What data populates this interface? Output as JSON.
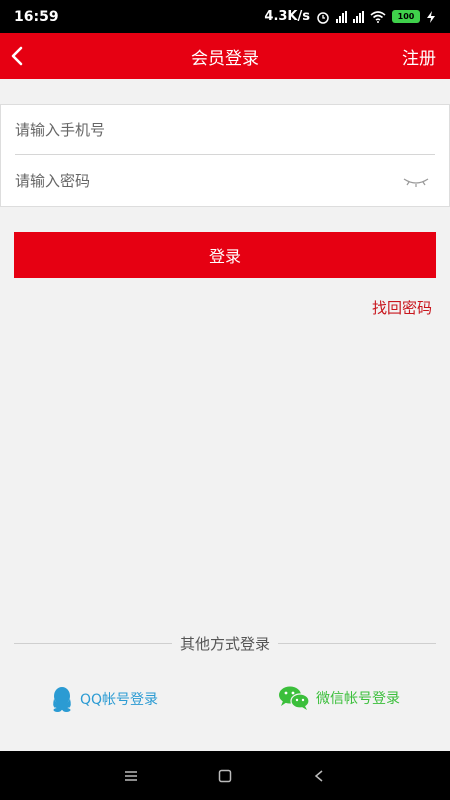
{
  "status_bar": {
    "time": "16:59",
    "speed": "4.3K/s",
    "battery": "100"
  },
  "nav": {
    "title": "会员登录",
    "register_label": "注册"
  },
  "form": {
    "phone_placeholder": "请输入手机号",
    "password_placeholder": "请输入密码"
  },
  "login_label": "登录",
  "forgot_label": "找回密码",
  "divider_label": "其他方式登录",
  "social": {
    "qq_label": "QQ帐号登录",
    "wechat_label": "微信帐号登录"
  },
  "colors": {
    "brand_red": "#e60012",
    "qq_blue": "#2b9bd3",
    "wechat_green": "#3bbf3b"
  }
}
